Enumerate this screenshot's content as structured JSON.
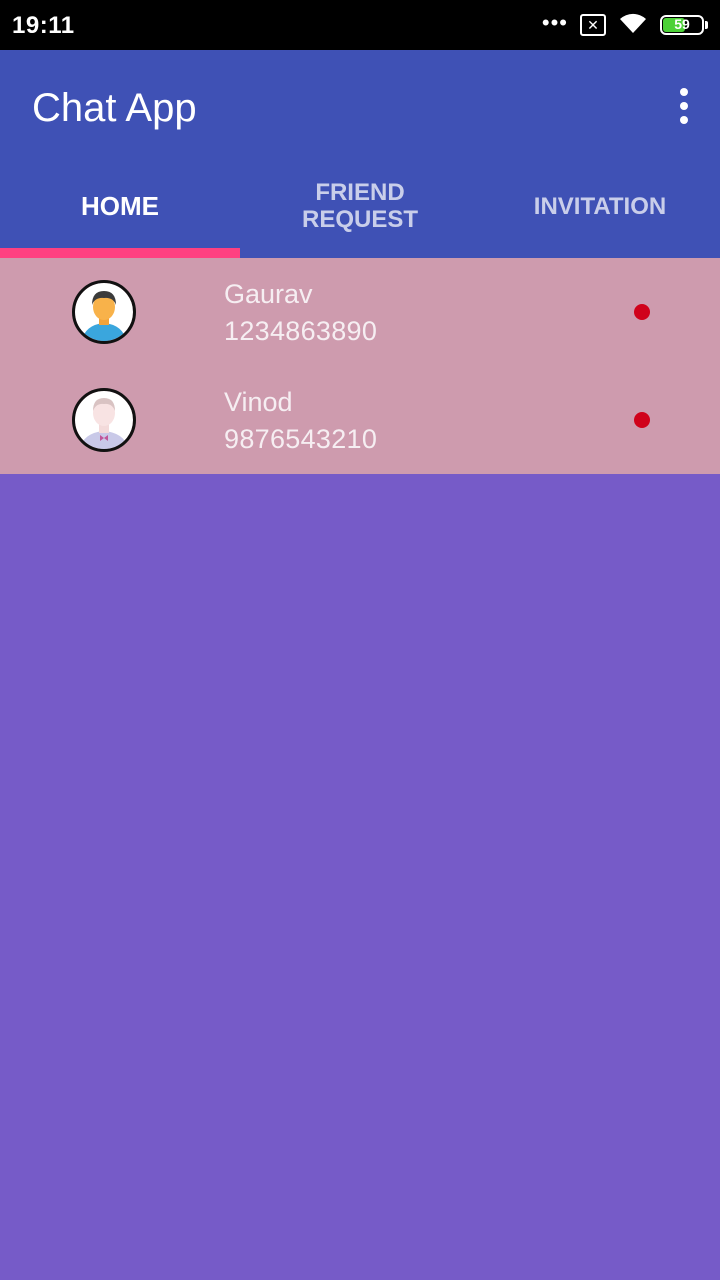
{
  "status_bar": {
    "time": "19:11",
    "dots": "•••",
    "sim_label": "✕",
    "battery_level": "59",
    "battery_fraction": 0.59,
    "icons": [
      "more-dots-icon",
      "no-sim-icon",
      "wifi-icon",
      "battery-icon"
    ]
  },
  "app_bar": {
    "title": "Chat App",
    "menu_icon": "overflow-menu-icon",
    "color": "#3f51b5"
  },
  "tabs": [
    {
      "label": "HOME",
      "active": true
    },
    {
      "label": "FRIEND\nREQUEST",
      "active": false
    },
    {
      "label": "INVITATION",
      "active": false
    }
  ],
  "contacts": [
    {
      "name": "Gaurav",
      "phone": "1234863890",
      "avatar": "man-avatar-icon",
      "status_color": "#d0021b"
    },
    {
      "name": "Vinod",
      "phone": "9876543210",
      "avatar": "man-bowtie-avatar-icon",
      "status_color": "#d0021b"
    }
  ],
  "colors": {
    "accent": "#ff4081",
    "list_background": "#ce9bae",
    "page_background": "#765bc8",
    "online_dot": "#d0021b"
  }
}
